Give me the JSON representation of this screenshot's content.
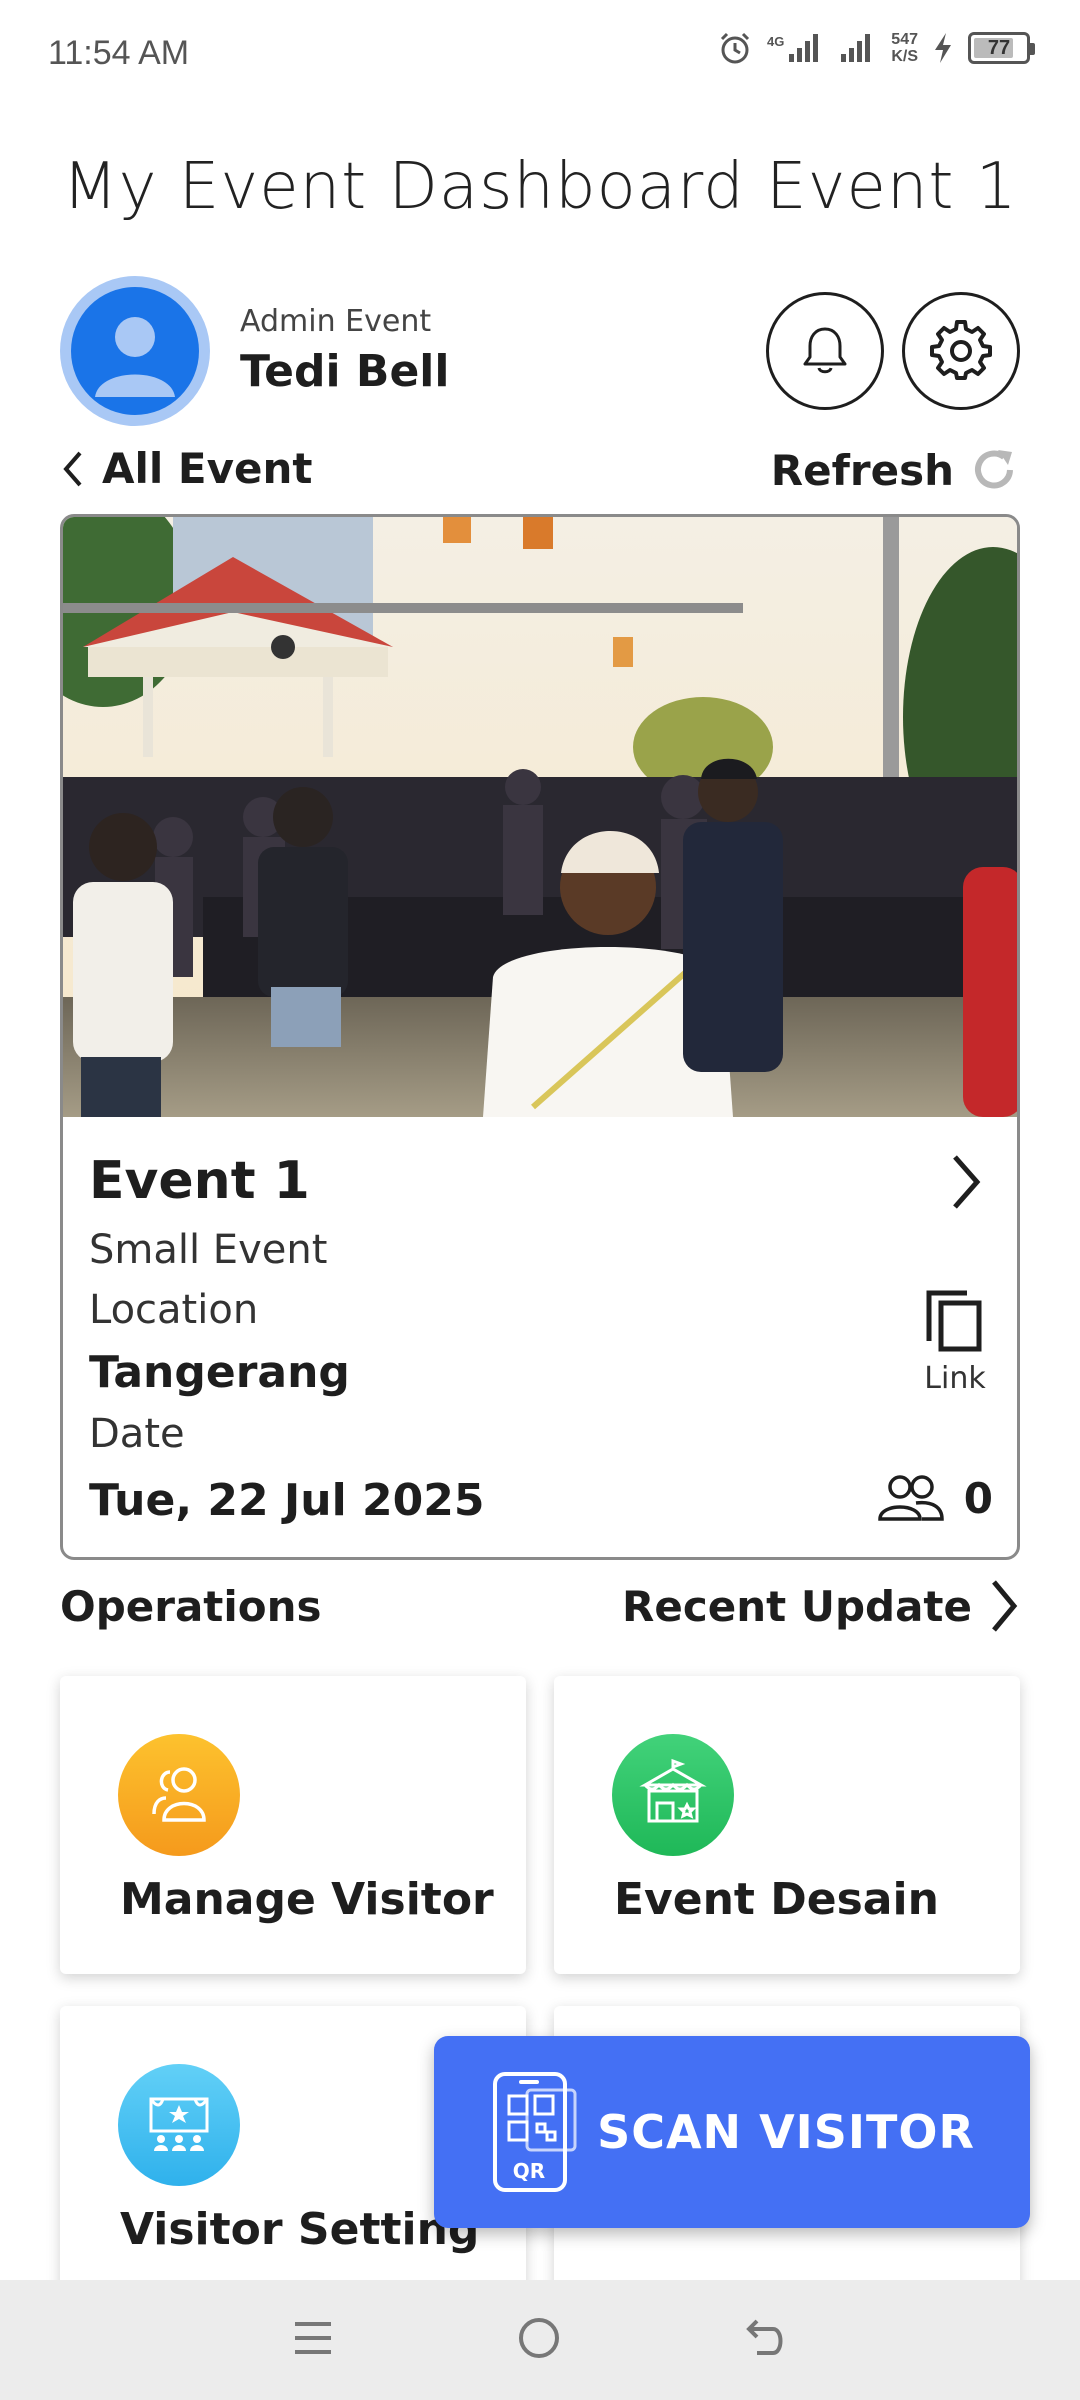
{
  "status_bar": {
    "time": "11:54 AM",
    "network_speed": "547",
    "network_unit": "K/S",
    "battery": "77",
    "battery_level": 0.77
  },
  "header": {
    "title": "My Event Dashboard Event 1"
  },
  "user": {
    "role": "Admin Event",
    "name": "Tedi Bell"
  },
  "nav": {
    "back_label": "All Event",
    "refresh_label": "Refresh"
  },
  "event": {
    "name": "Event 1",
    "type": "Small Event",
    "location_label": "Location",
    "location": "Tangerang",
    "date_label": "Date",
    "date": "Tue, 22 Jul 2025",
    "link_label": "Link",
    "visitor_count": "0"
  },
  "operations": {
    "title": "Operations",
    "recent_update_label": "Recent Update",
    "items": [
      {
        "label": "Manage Visitor",
        "icon": "users-icon",
        "color": "#f9a825"
      },
      {
        "label": "Event Desain",
        "icon": "booth-icon",
        "color": "#2ec866"
      },
      {
        "label": "Visitor Setting",
        "icon": "stage-icon",
        "color": "#44bff2"
      }
    ]
  },
  "fab": {
    "label": "SCAN VISITOR",
    "qr_text": "QR",
    "color": "#4470f4"
  }
}
